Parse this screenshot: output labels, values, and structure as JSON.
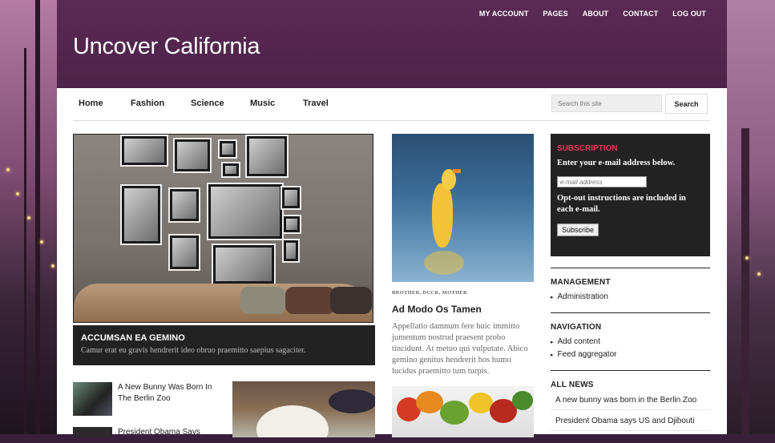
{
  "header": {
    "site_title": "Uncover California",
    "top_nav": [
      "MY ACCOUNT",
      "PAGES",
      "ABOUT",
      "CONTACT",
      "LOG OUT"
    ]
  },
  "main_nav": {
    "items": [
      "Home",
      "Fashion",
      "Science",
      "Music",
      "Travel"
    ],
    "search_placeholder": "Search this site",
    "search_button": "Search"
  },
  "featured": {
    "title": "ACCUMSAN EA GEMINO",
    "excerpt": "Camur erat eu gravis hendrerit ideo obruo praemitto saepius sagaciter."
  },
  "mini_posts": [
    {
      "title": "A New Bunny Was Born In The Berlin Zoo"
    },
    {
      "title": "President Obama Says"
    }
  ],
  "middle_post": {
    "tags": "BROTHER, DUCK, MOTHER",
    "title": "Ad Modo Os Tamen",
    "excerpt": "Appellatio damnum fere huic immitto jumentum nostrud praesent probo tincidunt. At metuo qui vulputate. Abico gemino genitus hendrerit hos humo lucidus praemitto tum turpis."
  },
  "sidebar": {
    "subscription": {
      "heading": "SUBSCRIPTION",
      "prompt": "Enter your e-mail address below.",
      "email_placeholder": "e-mail address",
      "optout": "Opt-out instructions are included in each e-mail.",
      "button": "Subscribe"
    },
    "management": {
      "heading": "MANAGEMENT",
      "links": [
        "Administration"
      ]
    },
    "navigation": {
      "heading": "NAVIGATION",
      "links": [
        "Add content",
        "Feed aggregator"
      ]
    },
    "all_news": {
      "heading": "ALL NEWS",
      "items": [
        "A new bunny was born in the Berlin Zoo",
        "President Obama says US and Djibouti"
      ]
    }
  },
  "colors": {
    "header_bg": "#4d2249",
    "accent_red": "#e23b5a",
    "dark_panel": "#222222"
  }
}
